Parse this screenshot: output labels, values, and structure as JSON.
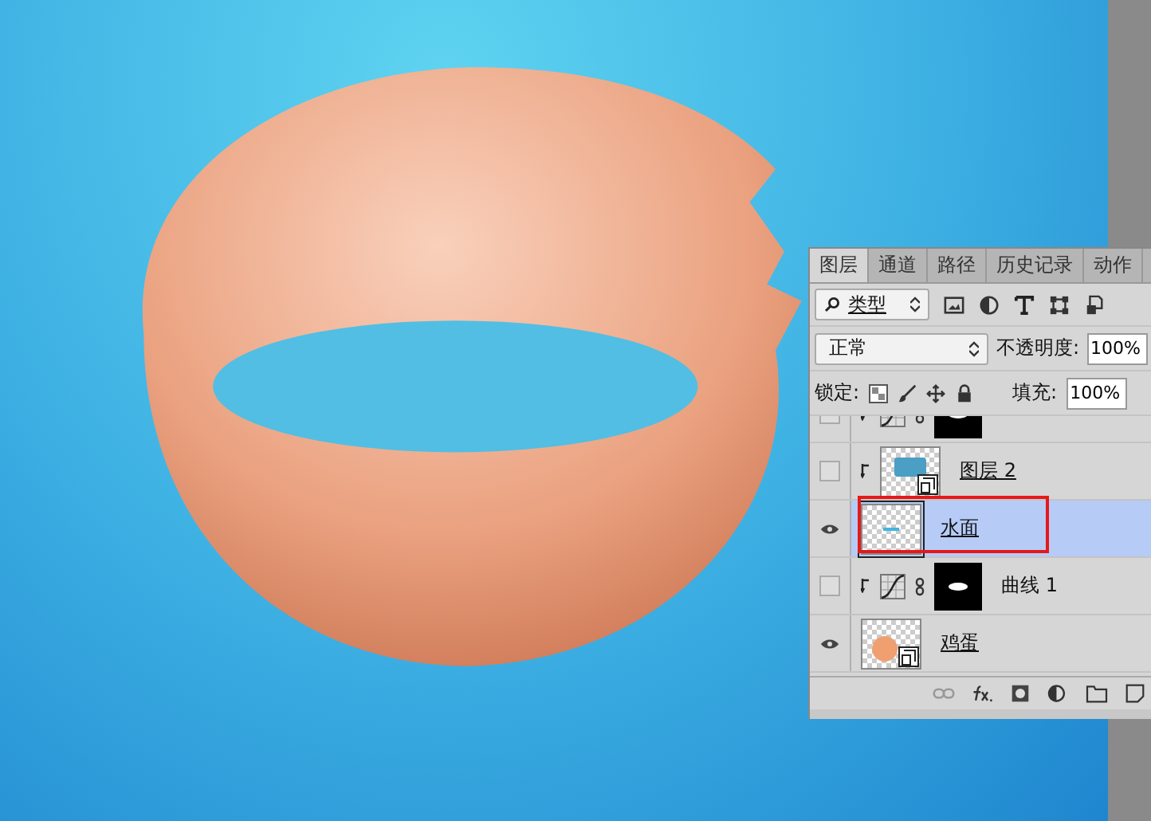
{
  "layers_panel": {
    "tabs": [
      {
        "label": "图层",
        "selected": true
      },
      {
        "label": "通道",
        "selected": false
      },
      {
        "label": "路径",
        "selected": false
      },
      {
        "label": "历史记录",
        "selected": false
      },
      {
        "label": "动作",
        "selected": false
      }
    ],
    "filter": {
      "value": "类型"
    },
    "blend_mode": {
      "value": "正常"
    },
    "opacity": {
      "label": "不透明度:",
      "value": "100%"
    },
    "lock": {
      "label": "锁定:"
    },
    "fill": {
      "label": "填充:",
      "value": "100%"
    },
    "layers": [
      {
        "kind": "curves",
        "visible": false,
        "selected": false,
        "clipped": true
      },
      {
        "kind": "smart",
        "name": "图层 2",
        "visible": false,
        "selected": false,
        "clipped": true,
        "highlight": false
      },
      {
        "kind": "normal",
        "name": "水面",
        "visible": true,
        "selected": true,
        "clipped": false,
        "highlight": true
      },
      {
        "kind": "curves",
        "name": "曲线 1",
        "visible": false,
        "selected": false,
        "clipped": true,
        "highlight": false
      },
      {
        "kind": "smart",
        "name": "鸡蛋",
        "visible": true,
        "selected": false,
        "clipped": false,
        "highlight": false
      }
    ]
  }
}
